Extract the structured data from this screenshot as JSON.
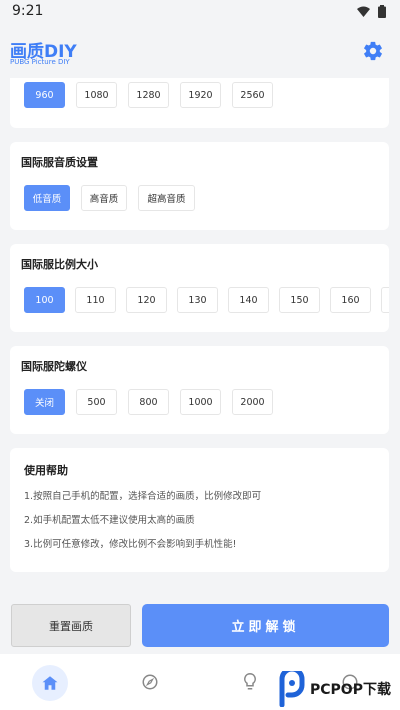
{
  "status_bar": {
    "time": "9:21"
  },
  "header": {
    "title": "画质DIY",
    "subtitle": "PUBG Picture DIY"
  },
  "resolution": {
    "options": [
      "960",
      "1080",
      "1280",
      "1920",
      "2560"
    ],
    "selected": "960"
  },
  "audio": {
    "title": "国际服音质设置",
    "options": [
      "低音质",
      "高音质",
      "超高音质"
    ],
    "selected": "低音质"
  },
  "ratio": {
    "title": "国际服比例大小",
    "options": [
      "100",
      "110",
      "120",
      "130",
      "140",
      "150",
      "160"
    ],
    "selected": "100"
  },
  "gyro": {
    "title": "国际服陀螺仪",
    "options": [
      "关闭",
      "500",
      "800",
      "1000",
      "2000"
    ],
    "selected": "关闭"
  },
  "help": {
    "title": "使用帮助",
    "lines": [
      "1.按照自己手机的配置，选择合适的画质，比例修改即可",
      "2.如手机配置太低不建议使用太高的画质",
      "3.比例可任意修改，修改比例不会影响到手机性能!"
    ]
  },
  "actions": {
    "reset_label": "重置画质",
    "unlock_label": "立即解锁"
  },
  "tabs": [
    "home-icon",
    "compass-icon",
    "lightbulb-icon",
    "circle-icon"
  ],
  "watermark": {
    "text": "PCPOP下载"
  },
  "colors": {
    "accent": "#5b8ff8",
    "title_blue": "#3f7ef6"
  }
}
